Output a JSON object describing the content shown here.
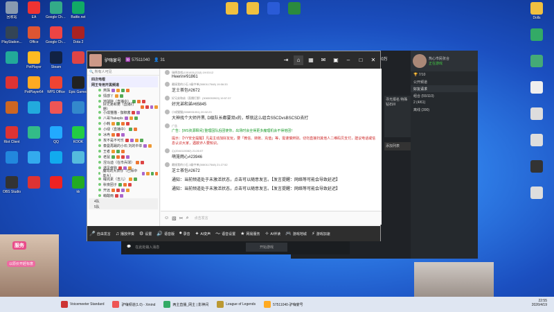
{
  "desktop_left": [
    {
      "label": "回收站",
      "color": "#889ab0"
    },
    {
      "label": "EA",
      "color": "#e33"
    },
    {
      "label": "Google Chrome",
      "color": "#3a8"
    },
    {
      "label": "Battle.net",
      "color": "#1a6"
    },
    {
      "label": "PlayStation...",
      "color": "#345"
    },
    {
      "label": "Office",
      "color": "#d53"
    },
    {
      "label": "Google Chrome",
      "color": "#e44"
    },
    {
      "label": "Dota 2",
      "color": "#a22"
    },
    {
      "label": "",
      "color": "#2a9"
    },
    {
      "label": "PotPlayer",
      "color": "#fb2"
    },
    {
      "label": "Steam",
      "color": "#124"
    },
    {
      "label": "",
      "color": "#d44"
    },
    {
      "label": "",
      "color": "#d33"
    },
    {
      "label": "PotPlayer64",
      "color": "#fa2"
    },
    {
      "label": "WPS Office",
      "color": "#e43"
    },
    {
      "label": "Epic Games",
      "color": "#222"
    },
    {
      "label": "",
      "color": "#c62"
    },
    {
      "label": "",
      "color": "#2ad"
    },
    {
      "label": "",
      "color": "#e55"
    },
    {
      "label": "",
      "color": "#38c"
    },
    {
      "label": "Riot Client",
      "color": "#d33"
    },
    {
      "label": "",
      "color": "#3b8"
    },
    {
      "label": "QQ",
      "color": "#2af"
    },
    {
      "label": "KOOK",
      "color": "#2c4"
    },
    {
      "label": "",
      "color": "#28d"
    },
    {
      "label": "",
      "color": "#3ae"
    },
    {
      "label": "",
      "color": "#1ae"
    },
    {
      "label": "",
      "color": "#5bd"
    },
    {
      "label": "OBS Studio",
      "color": "#333"
    },
    {
      "label": "",
      "color": "#d33"
    },
    {
      "label": "",
      "color": "#e22"
    },
    {
      "label": "kk",
      "color": "#2a2"
    }
  ],
  "desktop_top": [
    {
      "label": "",
      "color": "#f0c040"
    },
    {
      "label": "",
      "color": "#f0c040"
    },
    {
      "label": "",
      "color": "#2a5bd7"
    },
    {
      "label": "",
      "color": "#2b8a3e"
    }
  ],
  "desktop_right": [
    {
      "label": "Dolls",
      "color": "#f0c040"
    },
    {
      "label": "",
      "color": "#3a6"
    },
    {
      "label": "",
      "color": "#4a7"
    },
    {
      "label": "",
      "color": "#eee"
    },
    {
      "label": "",
      "color": "#ddd"
    },
    {
      "label": "",
      "color": "#ddd"
    },
    {
      "label": "",
      "color": "#333"
    },
    {
      "label": "",
      "color": "#ddd"
    }
  ],
  "chat": {
    "title": "驴嗨宴号",
    "room_id": "57511040",
    "online": "31",
    "search_placeholder": "所有人可见",
    "channels": [
      {
        "label": "四次电棍",
        "kind": "group"
      },
      {
        "label": "网王专用开黑频道",
        "kind": "group"
      },
      {
        "label": "燕珠",
        "kind": "sub"
      },
      {
        "label": "情感丫",
        "kind": "sub"
      },
      {
        "label": "地球胖（直播中）",
        "kind": "sub"
      },
      {
        "label": "好兄弟和弟（直播打野）",
        "kind": "sub"
      },
      {
        "label": "小成猫猫 - 伽椒酱",
        "kind": "sub"
      },
      {
        "label": "八哥7takepls",
        "kind": "sub"
      },
      {
        "label": "小韩",
        "kind": "sub"
      },
      {
        "label": "小绿（直播中）",
        "kind": "sub"
      },
      {
        "label": "冰冉",
        "kind": "sub"
      },
      {
        "label": "攻不是不可乐",
        "kind": "sub"
      },
      {
        "label": "泰曼再踢的小石 刘的中单",
        "kind": "sub"
      },
      {
        "label": "王者",
        "kind": "sub"
      },
      {
        "label": "老鼠",
        "kind": "sub"
      },
      {
        "label": "涅马迪（在市兵球）",
        "kind": "sub"
      },
      {
        "label": "遇见傻狗",
        "kind": "sub"
      },
      {
        "label": "魔驾的大表仔（已拜中单大）",
        "kind": "sub"
      },
      {
        "label": "睡完素（吉儿）",
        "kind": "sub"
      },
      {
        "label": "秋夜团子",
        "kind": "sub"
      },
      {
        "label": "开远",
        "kind": "sub"
      },
      {
        "label": "萌酸雨",
        "kind": "sub"
      },
      {
        "label": "4队",
        "kind": "bottom"
      },
      {
        "label": "5队",
        "kind": "bottom"
      }
    ],
    "messages": [
      {
        "meta": "瑞德游戏(1351831(22)3) 19:53:12",
        "text": "Heerin#91861",
        "style": ""
      },
      {
        "meta": "最接我的小石 3级中单(3080117548) 19:56:33",
        "text": "芝士茶包#2672",
        "style": ""
      },
      {
        "meta": "好兄弟和弟（直播打野）(3083053903) 19:57:37",
        "text": "好兄弟和弟#65845",
        "style": ""
      },
      {
        "meta": "小成猫猫(3308931051) 20:02:23",
        "text": "大神找个大师开黑, D级队长都要双x的，帮就这么组合S5CDvsBSCSD去打",
        "style": ""
      },
      {
        "meta": "广告",
        "text": "广告：[WS资源瞬间] 整理因队后团使你，出场时会全得更多魔理机会不得他团！",
        "style": "green"
      },
      {
        "meta": "",
        "text": "提示：【YY安全提醒】凡是主动加好友玩，要「微信、转账、充值」等，需谨慎辨别。切勿直接扫其他人二维码贝支付，建议电话或信息认识大家，遇欺诈人要知识。",
        "style": "red"
      },
      {
        "meta": "心(2044115082) 21:26:07",
        "text": "萌笼雨心#23946",
        "style": ""
      },
      {
        "meta": "最接我的小石 3级中单(3080117548) 21:27:52",
        "text": "芝士茶包#2672",
        "style": ""
      },
      {
        "meta": "",
        "text": "通知：当前频道处于未激活状态，点击可以随意发言。【发言提醒：网络等可能会导致延迟】",
        "style": ""
      },
      {
        "meta": "",
        "text": "通知：当前频道处于未激活状态，点击可以随意发言。【发言提醒：网络等可能会导致延迟】",
        "style": ""
      }
    ],
    "input_placeholder": "点击发言",
    "bottom_bar": [
      {
        "icon": "mic",
        "label": "自由发言"
      },
      {
        "icon": "music",
        "label": "播放伴奏"
      },
      {
        "icon": "gear",
        "label": "设置"
      },
      {
        "icon": "speaker",
        "label": "语音版"
      },
      {
        "icon": "rec",
        "label": "录音"
      },
      {
        "icon": "ai",
        "label": "AI变声"
      },
      {
        "icon": "wave",
        "label": "语音设置"
      },
      {
        "icon": "star",
        "label": "网易服务"
      },
      {
        "icon": "ai2",
        "label": "AI伴读"
      },
      {
        "icon": "game",
        "label": "游戏地城"
      },
      {
        "icon": "fav",
        "label": "游戏加速"
      }
    ]
  },
  "side_panel": {
    "name": "热心市民张合",
    "sub": "正在游戏",
    "level": "7/10",
    "rows": [
      {
        "label": "公开频道",
        "kind": "row"
      },
      {
        "label": "好友请求",
        "kind": "sec"
      },
      {
        "label": "组合 (55/110)",
        "kind": "row"
      },
      {
        "label": "2 (4/61)",
        "kind": "row"
      },
      {
        "label": "离线 (390)",
        "kind": "row"
      }
    ],
    "box1": "寻光报名 特殊钻石III",
    "box2": "添加列表"
  },
  "coins": "10万",
  "under_window": {
    "placeholder": "在此处输入消息",
    "button": "开始游戏"
  },
  "taskbar": {
    "items": [
      {
        "label": "Voicemeeter Standard",
        "color": "#c33"
      },
      {
        "label": "驴嗨频道(1.0) - Xmind",
        "color": "#e55"
      },
      {
        "label": "两主直播_网主 | 影神间",
        "color": "#3a6"
      },
      {
        "label": "League of Legends",
        "color": "#b93"
      },
      {
        "label": "57511040-驴嗨宴号",
        "color": "#fa2"
      }
    ],
    "time": "22:55",
    "date": "2026/4/19"
  },
  "webcam_left": {
    "promo": "服务",
    "promo2": "以原价开赶标意"
  }
}
